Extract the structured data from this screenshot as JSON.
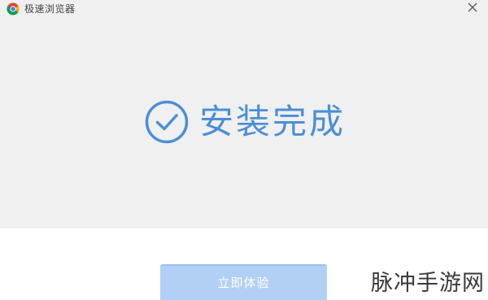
{
  "window": {
    "title": "极速浏览器",
    "logo_icon": "chrome-logo-icon",
    "close_icon": "close-icon"
  },
  "status": {
    "icon": "check-circle-icon",
    "text": "安装完成",
    "color": "#4a8fd6"
  },
  "action": {
    "button_label": "立即体验",
    "button_color": "#b2d0f5"
  },
  "watermark": {
    "text": "脉冲手游网"
  },
  "colors": {
    "panel_background": "#f0f0f0",
    "page_background": "#ffffff"
  }
}
